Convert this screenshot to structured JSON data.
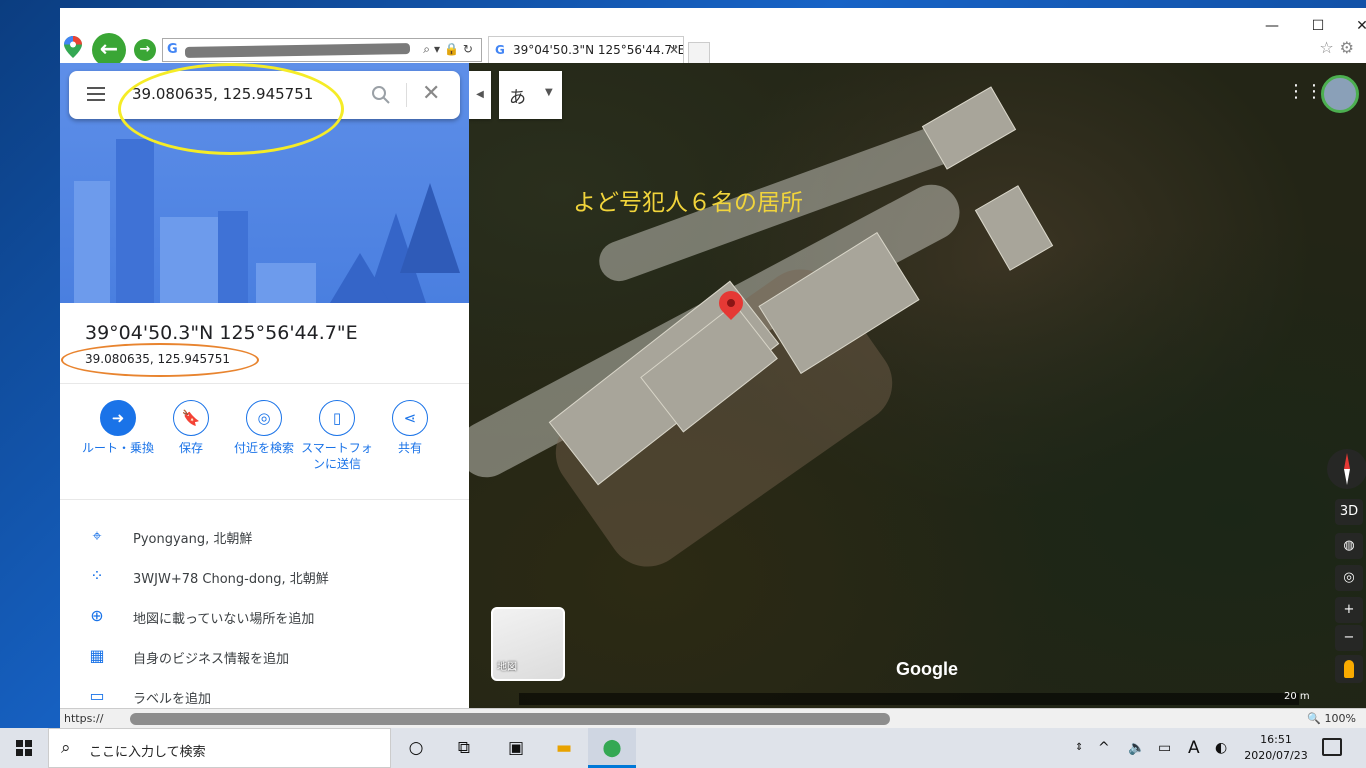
{
  "browser": {
    "tab_title": "39°04'50.3\"N 125°56'44.7\"E ...",
    "tab_close": "✕",
    "address_glyph": "G",
    "window_controls": {
      "minimize": "—",
      "maximize": "☐",
      "close": "✕"
    }
  },
  "search": {
    "value": "39.080635, 125.945751"
  },
  "place": {
    "title": "39°04'50.3\"N 125°56'44.7\"E",
    "subtitle": "39.080635, 125.945751"
  },
  "actions": [
    {
      "label": "ルート・乗換",
      "icon": "directions-icon",
      "glyph": "➜"
    },
    {
      "label": "保存",
      "icon": "bookmark-icon",
      "glyph": "🔖"
    },
    {
      "label": "付近を検索",
      "icon": "nearby-icon",
      "glyph": "◎"
    },
    {
      "label": "スマートフォンに送信",
      "icon": "send-to-phone-icon",
      "glyph": "▯"
    },
    {
      "label": "共有",
      "icon": "share-icon",
      "glyph": "⋖"
    }
  ],
  "info_rows": [
    {
      "text": "Pyongyang, 北朝鮮",
      "icon": "location-pin-icon",
      "glyph": "⌖"
    },
    {
      "text": "3WJW+78 Chong-dong, 北朝鮮",
      "icon": "plus-code-icon",
      "glyph": "⁘"
    },
    {
      "text": "地図に載っていない場所を追加",
      "icon": "add-place-icon",
      "glyph": "⊕"
    },
    {
      "text": "自身のビジネス情報を追加",
      "icon": "add-business-icon",
      "glyph": "▦"
    },
    {
      "text": "ラベルを追加",
      "icon": "label-icon",
      "glyph": "▭"
    }
  ],
  "map": {
    "annotation": "よど号犯人６名の居所",
    "ime_char": "あ",
    "layer_label": "地図",
    "logo": "Google",
    "scale": "20 m",
    "controls": {
      "three_d": "3D",
      "zoom_in": "+",
      "zoom_out": "−"
    }
  },
  "statusbar": {
    "url_prefix": "https://",
    "zoom": "🔍 100%"
  },
  "taskbar": {
    "search_placeholder": "ここに入力して検索",
    "clock_time": "16:51",
    "clock_date": "2020/07/23",
    "ime_indicator": "A"
  },
  "colors": {
    "accent": "#1a73e8",
    "annotation_yellow": "#f1d43b",
    "highlight_circle_yellow": "#f5ec27",
    "highlight_circle_orange": "#e8842f",
    "pin_red": "#e53935",
    "nav_green": "#3aa635"
  }
}
